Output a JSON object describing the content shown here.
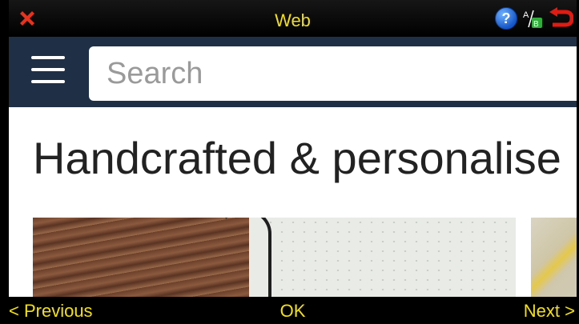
{
  "titlebar": {
    "title": "Web",
    "close_icon": "close-icon",
    "help_icon": "help-icon",
    "help_glyph": "?",
    "translate_icon": "translate-icon",
    "back_icon": "back-icon"
  },
  "appbar": {
    "menu_icon": "hamburger-menu-icon",
    "search_placeholder": "Search"
  },
  "content": {
    "heading": "Handcrafted & personalise"
  },
  "softkeys": {
    "previous": "< Previous",
    "ok": "OK",
    "next": "Next >"
  },
  "colors": {
    "accent_yellow": "#f4e10a",
    "header_navy": "#1f2f45",
    "close_red": "#e8321e",
    "back_red": "#e21b12"
  }
}
